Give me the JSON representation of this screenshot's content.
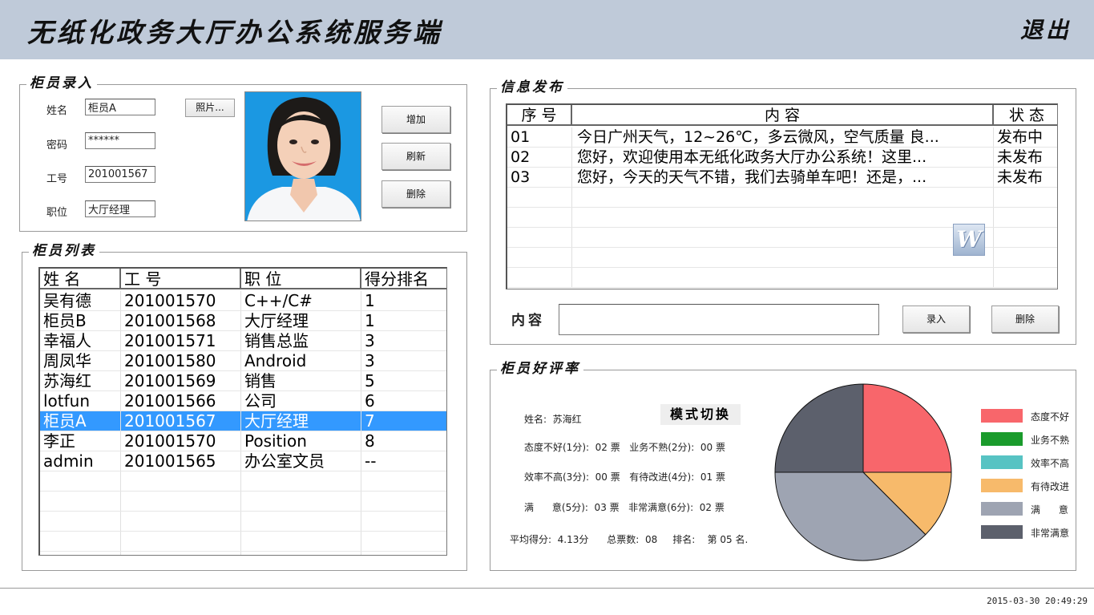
{
  "header": {
    "title": "无纸化政务大厅办公系统服务端",
    "exit_label": "退出"
  },
  "entry": {
    "title": "柜员录入",
    "name_label": "姓名",
    "name_value": "柜员A",
    "password_label": "密码",
    "password_value": "******",
    "id_label": "工号",
    "id_value": "201001567",
    "position_label": "职位",
    "position_value": "大厅经理",
    "photo_button": "照片...",
    "add_button": "增加",
    "refresh_button": "刷新",
    "delete_button": "删除"
  },
  "staff_list": {
    "title": "柜员列表",
    "columns": [
      "姓 名",
      "工 号",
      "职  位",
      "得分排名"
    ],
    "rows": [
      [
        "吴有德",
        "201001570",
        "C++/C#",
        "1"
      ],
      [
        "柜员B",
        "201001568",
        "大厅经理",
        "1"
      ],
      [
        "幸福人",
        "201001571",
        "销售总监",
        "3"
      ],
      [
        "周凤华",
        "201001580",
        "Android",
        "3"
      ],
      [
        "苏海红",
        "201001569",
        "销售",
        "5"
      ],
      [
        "lotfun",
        "201001566",
        "公司",
        "6"
      ],
      [
        "柜员A",
        "201001567",
        "大厅经理",
        "7"
      ],
      [
        "李正",
        "201001570",
        "Position",
        "8"
      ],
      [
        "admin",
        "201001565",
        "办公室文员",
        "--"
      ]
    ],
    "selected_index": 6,
    "empty_rows": 5
  },
  "info": {
    "title": "信息发布",
    "columns": [
      "序  号",
      "内            容",
      "状  态"
    ],
    "rows": [
      [
        "01",
        "今日广州天气，12~26℃，多云微风，空气质量 良...",
        "发布中"
      ],
      [
        "02",
        "您好，欢迎使用本无纸化政务大厅办公系统！这里...",
        "未发布"
      ],
      [
        "03",
        "您好，今天的天气不错，我们去骑单车吧！还是，...",
        "未发布"
      ]
    ],
    "empty_rows": 5,
    "content_label": "内容",
    "content_value": "",
    "record_button": "录入",
    "delete_button": "删除"
  },
  "rating": {
    "title": "柜员好评率",
    "name_line": "姓名:  苏海红",
    "mode_button": "模式切换",
    "line1": "态度不好(1分):  02 票   业务不熟(2分):  00 票",
    "line2": "效率不高(3分):  00 票   有待改进(4分):  01 票",
    "line3": "满      意(5分):  03 票   非常满意(6分):  02 票",
    "summary": "平均得分:  4.13分      总票数:  08     排名:    第 05 名."
  },
  "chart_data": {
    "type": "pie",
    "categories": [
      "态度不好",
      "业务不熟",
      "效率不高",
      "有待改进",
      "满      意",
      "非常满意"
    ],
    "values": [
      2,
      0,
      0,
      1,
      3,
      2
    ],
    "colors": [
      "#f8666b",
      "#1a9b2c",
      "#57c3c3",
      "#f7ba6b",
      "#9ea4b2",
      "#5c606c"
    ],
    "start_angle_deg": 0,
    "direction": "clockwise-from-top",
    "legend": "right"
  },
  "icons": {
    "word": "word-document-icon"
  },
  "status": {
    "timestamp": "2015-03-30  20:49:29"
  }
}
